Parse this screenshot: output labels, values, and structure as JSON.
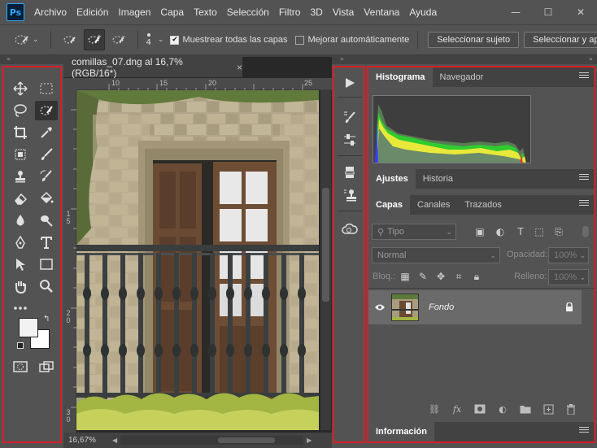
{
  "app": {
    "logo": "Ps"
  },
  "menu": [
    "Archivo",
    "Edición",
    "Imagen",
    "Capa",
    "Texto",
    "Selección",
    "Filtro",
    "3D",
    "Vista",
    "Ventana",
    "Ayuda"
  ],
  "window_controls": {
    "minimize": "—",
    "maximize": "☐",
    "close": "✕"
  },
  "options_bar": {
    "brush_size": "4",
    "sample_all_layers": {
      "label": "Muestrear todas las capas",
      "checked": true
    },
    "auto_enhance": {
      "label": "Mejorar automáticamente",
      "checked": false
    },
    "select_subject": "Seleccionar sujeto",
    "select_and_mask": "Seleccionar y apli"
  },
  "document": {
    "tab_title": "comillas_07.dng al 16,7% (RGB/16*)",
    "tab_close": "×",
    "zoom": "16,67%",
    "ruler_h": [
      "10",
      "15",
      "20",
      "25"
    ],
    "ruler_v": [
      "1\n5",
      "2\n0",
      "2\n5",
      "3\n0"
    ]
  },
  "panels": {
    "histogram_tabs": [
      "Histograma",
      "Navegador"
    ],
    "adjust_tabs": [
      "Ajustes",
      "Historia"
    ],
    "layers_tabs": [
      "Capas",
      "Canales",
      "Trazados"
    ],
    "info_tabs": [
      "Información"
    ],
    "layer_filter": "Tipo",
    "blend_mode": "Normal",
    "opacity_label": "Opacidad:",
    "opacity_value": "100%",
    "lock_label": "Bloq.:",
    "fill_label": "Relleno:",
    "fill_value": "100%",
    "layer": {
      "name": "Fondo"
    },
    "footer_fx": "fx"
  },
  "colors": {
    "accent_highlight": "#d81e28",
    "panel_bg": "#535353",
    "tab_bar": "#424242",
    "canvas_bg": "#282828"
  }
}
